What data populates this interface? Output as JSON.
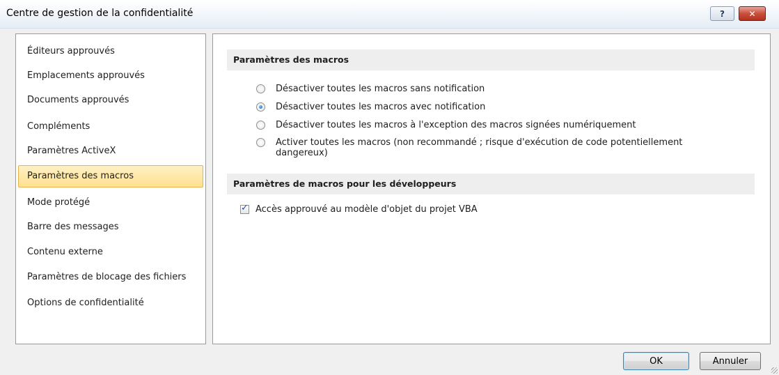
{
  "window": {
    "title": "Centre de gestion de la confidentialité",
    "help_symbol": "?",
    "close_symbol": "✕"
  },
  "sidebar": {
    "items": [
      {
        "label": "Éditeurs approuvés",
        "active": false
      },
      {
        "label": "Emplacements approuvés",
        "active": false
      },
      {
        "label": "Documents approuvés",
        "active": false
      },
      {
        "label": "Compléments",
        "active": false
      },
      {
        "label": "Paramètres ActiveX",
        "active": false
      },
      {
        "label": "Paramètres des macros",
        "active": true
      },
      {
        "label": "Mode protégé",
        "active": false
      },
      {
        "label": "Barre des messages",
        "active": false
      },
      {
        "label": "Contenu externe",
        "active": false
      },
      {
        "label": "Paramètres de blocage des fichiers",
        "active": false
      },
      {
        "label": "Options de confidentialité",
        "active": false
      }
    ]
  },
  "macros": {
    "header": "Paramètres des macros",
    "options": [
      {
        "label": "Désactiver toutes les macros sans notification",
        "checked": false
      },
      {
        "label": "Désactiver toutes les macros avec notification",
        "checked": true
      },
      {
        "label": "Désactiver toutes les macros à l'exception des macros signées numériquement",
        "checked": false
      },
      {
        "label": "Activer toutes les macros (non recommandé ; risque d'exécution de code potentiellement",
        "label_line2": "dangereux)",
        "checked": false
      }
    ]
  },
  "developer": {
    "header": "Paramètres de macros pour les développeurs",
    "vba_access": {
      "label": "Accès approuvé au modèle d'objet du projet VBA",
      "checked": true
    }
  },
  "footer": {
    "ok_label": "OK",
    "cancel_label": "Annuler"
  }
}
